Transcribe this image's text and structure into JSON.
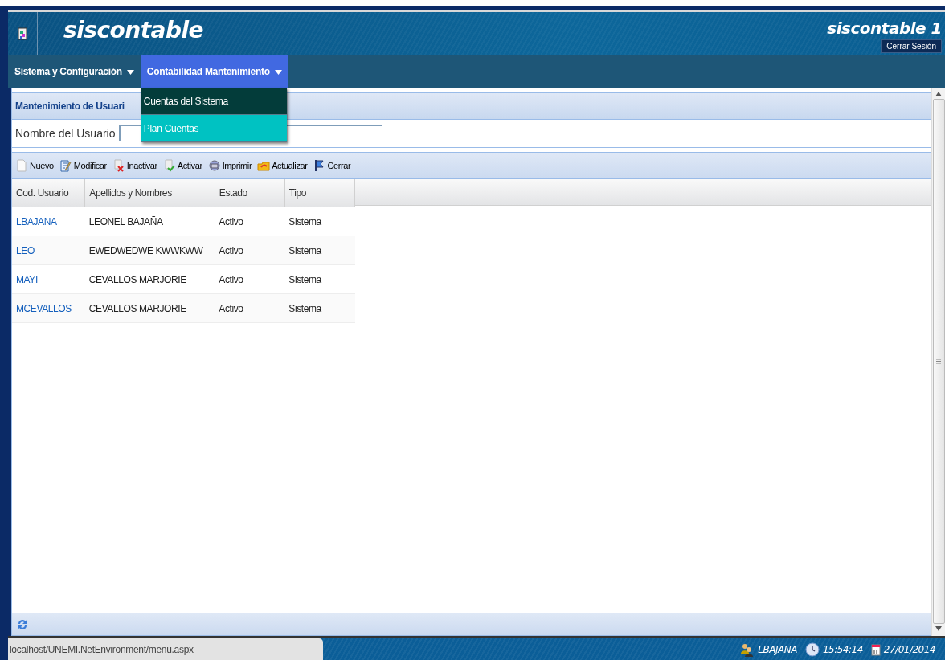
{
  "header": {
    "title": "siscontable",
    "right_title": "siscontable 1",
    "logout_button": "Cerrar Sesión"
  },
  "menu": [
    {
      "label": "Sistema y Configuración",
      "selected": false
    },
    {
      "label": "Contabilidad Mantenimiento",
      "selected": true,
      "items": [
        {
          "label": "Cuentas del Sistema",
          "selected": false
        },
        {
          "label": "Plan Cuentas",
          "selected": true
        }
      ]
    }
  ],
  "panel": {
    "title": "Mantenimiento de Usuari",
    "search_label": "Nombre del Usuario",
    "toolbar": [
      {
        "kind": "new",
        "label": "Nuevo"
      },
      {
        "kind": "edit",
        "label": "Modificar"
      },
      {
        "kind": "deactivate",
        "label": "Inactivar"
      },
      {
        "kind": "activate",
        "label": "Activar"
      },
      {
        "kind": "print",
        "label": "Imprimir"
      },
      {
        "kind": "refresh",
        "label": "Actualizar"
      },
      {
        "kind": "close",
        "label": "Cerrar"
      }
    ],
    "table": {
      "columns": [
        "Cod. Usuario",
        "Apellidos y Nombres",
        "Estado",
        "Tipo"
      ],
      "rows": [
        [
          "LBAJANA",
          "LEONEL BAJAÑA",
          "Activo",
          "Sistema"
        ],
        [
          "LEO",
          "EWEDWEDWE KWWKWW",
          "Activo",
          "Sistema"
        ],
        [
          "MAYI",
          "CEVALLOS MARJORIE",
          "Activo",
          "Sistema"
        ],
        [
          "MCEVALLOS",
          "CEVALLOS MARJORIE",
          "Activo",
          "Sistema"
        ]
      ]
    }
  },
  "status_bar": {
    "url": "localhost/UNEMI.NetEnvironment/menu.aspx",
    "user": "LBAJANA",
    "time": "15:54:14",
    "date": "27/01/2014"
  }
}
